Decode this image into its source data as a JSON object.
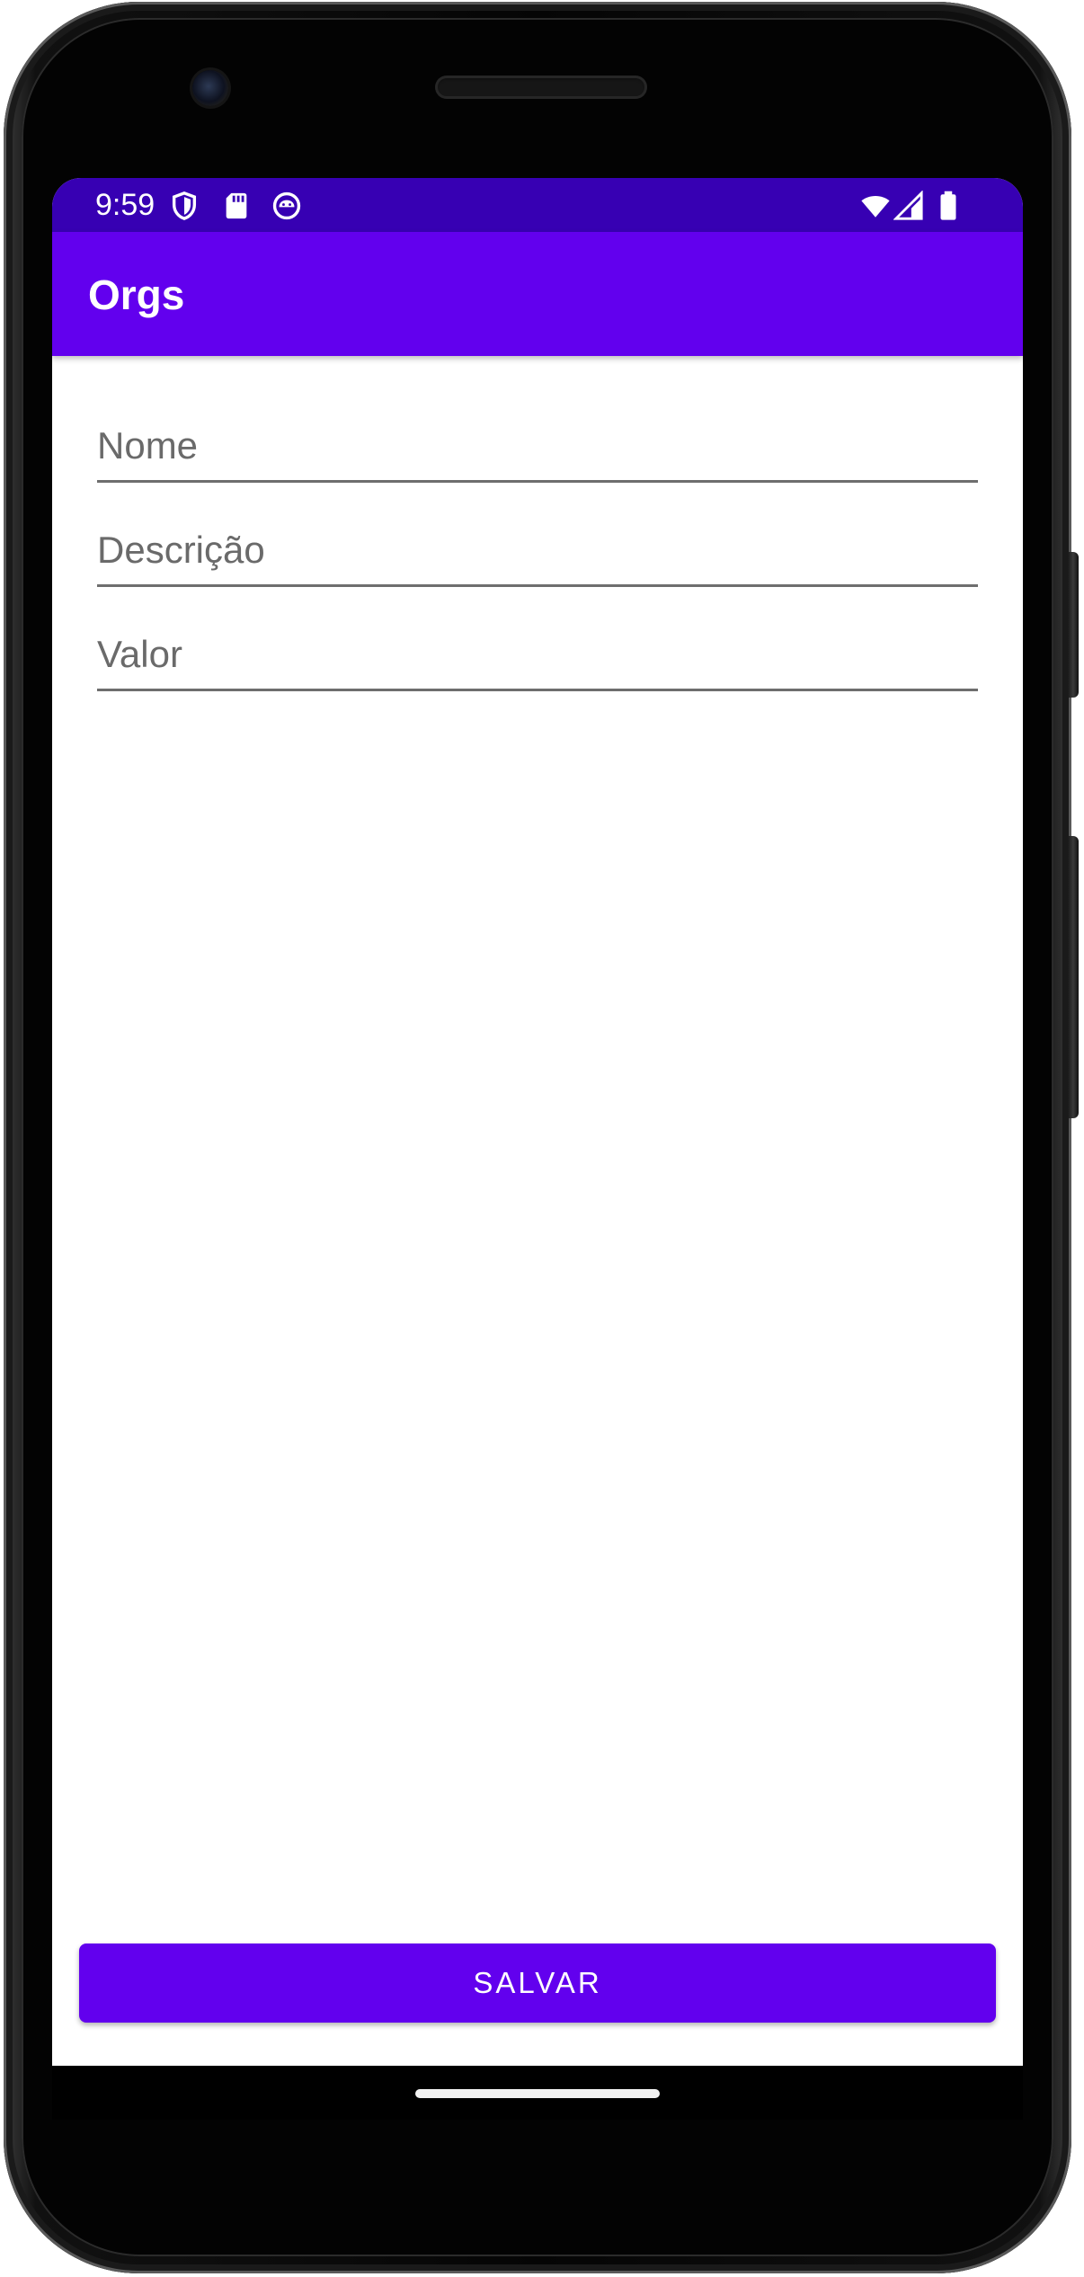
{
  "status_bar": {
    "time": "9:59",
    "left_icons": [
      "shield-icon",
      "sd-card-icon",
      "emulator-icon"
    ],
    "right_icons": [
      "wifi-icon",
      "signal-icon",
      "battery-icon"
    ]
  },
  "app_bar": {
    "title": "Orgs"
  },
  "form": {
    "fields": [
      {
        "name": "nome",
        "placeholder": "Nome",
        "value": ""
      },
      {
        "name": "descricao",
        "placeholder": "Descrição",
        "value": ""
      },
      {
        "name": "valor",
        "placeholder": "Valor",
        "value": ""
      }
    ]
  },
  "actions": {
    "save_label": "SALVAR"
  },
  "colors": {
    "status_bar": "#3700b3",
    "primary": "#6200ee",
    "on_primary": "#ffffff",
    "background": "#ffffff"
  }
}
